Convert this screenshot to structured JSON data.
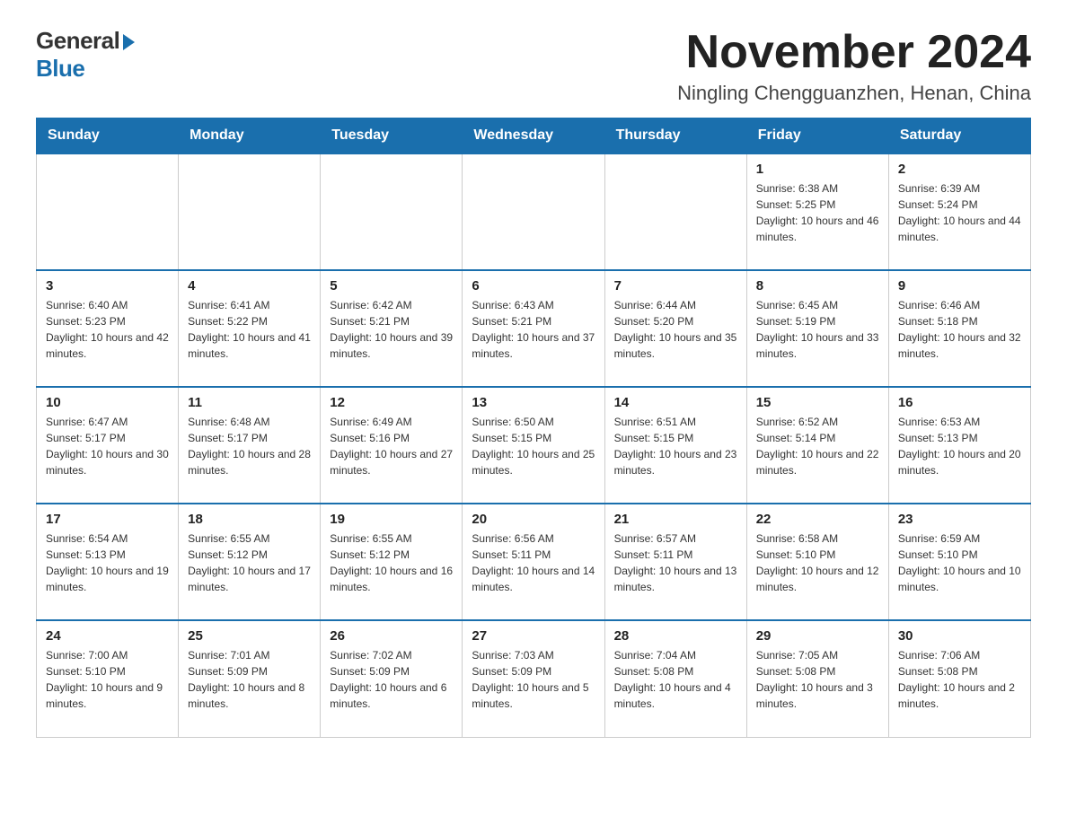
{
  "logo": {
    "general": "General",
    "blue": "Blue"
  },
  "header": {
    "month": "November 2024",
    "location": "Ningling Chengguanzhen, Henan, China"
  },
  "weekdays": [
    "Sunday",
    "Monday",
    "Tuesday",
    "Wednesday",
    "Thursday",
    "Friday",
    "Saturday"
  ],
  "weeks": [
    [
      {
        "day": "",
        "sunrise": "",
        "sunset": "",
        "daylight": ""
      },
      {
        "day": "",
        "sunrise": "",
        "sunset": "",
        "daylight": ""
      },
      {
        "day": "",
        "sunrise": "",
        "sunset": "",
        "daylight": ""
      },
      {
        "day": "",
        "sunrise": "",
        "sunset": "",
        "daylight": ""
      },
      {
        "day": "",
        "sunrise": "",
        "sunset": "",
        "daylight": ""
      },
      {
        "day": "1",
        "sunrise": "Sunrise: 6:38 AM",
        "sunset": "Sunset: 5:25 PM",
        "daylight": "Daylight: 10 hours and 46 minutes."
      },
      {
        "day": "2",
        "sunrise": "Sunrise: 6:39 AM",
        "sunset": "Sunset: 5:24 PM",
        "daylight": "Daylight: 10 hours and 44 minutes."
      }
    ],
    [
      {
        "day": "3",
        "sunrise": "Sunrise: 6:40 AM",
        "sunset": "Sunset: 5:23 PM",
        "daylight": "Daylight: 10 hours and 42 minutes."
      },
      {
        "day": "4",
        "sunrise": "Sunrise: 6:41 AM",
        "sunset": "Sunset: 5:22 PM",
        "daylight": "Daylight: 10 hours and 41 minutes."
      },
      {
        "day": "5",
        "sunrise": "Sunrise: 6:42 AM",
        "sunset": "Sunset: 5:21 PM",
        "daylight": "Daylight: 10 hours and 39 minutes."
      },
      {
        "day": "6",
        "sunrise": "Sunrise: 6:43 AM",
        "sunset": "Sunset: 5:21 PM",
        "daylight": "Daylight: 10 hours and 37 minutes."
      },
      {
        "day": "7",
        "sunrise": "Sunrise: 6:44 AM",
        "sunset": "Sunset: 5:20 PM",
        "daylight": "Daylight: 10 hours and 35 minutes."
      },
      {
        "day": "8",
        "sunrise": "Sunrise: 6:45 AM",
        "sunset": "Sunset: 5:19 PM",
        "daylight": "Daylight: 10 hours and 33 minutes."
      },
      {
        "day": "9",
        "sunrise": "Sunrise: 6:46 AM",
        "sunset": "Sunset: 5:18 PM",
        "daylight": "Daylight: 10 hours and 32 minutes."
      }
    ],
    [
      {
        "day": "10",
        "sunrise": "Sunrise: 6:47 AM",
        "sunset": "Sunset: 5:17 PM",
        "daylight": "Daylight: 10 hours and 30 minutes."
      },
      {
        "day": "11",
        "sunrise": "Sunrise: 6:48 AM",
        "sunset": "Sunset: 5:17 PM",
        "daylight": "Daylight: 10 hours and 28 minutes."
      },
      {
        "day": "12",
        "sunrise": "Sunrise: 6:49 AM",
        "sunset": "Sunset: 5:16 PM",
        "daylight": "Daylight: 10 hours and 27 minutes."
      },
      {
        "day": "13",
        "sunrise": "Sunrise: 6:50 AM",
        "sunset": "Sunset: 5:15 PM",
        "daylight": "Daylight: 10 hours and 25 minutes."
      },
      {
        "day": "14",
        "sunrise": "Sunrise: 6:51 AM",
        "sunset": "Sunset: 5:15 PM",
        "daylight": "Daylight: 10 hours and 23 minutes."
      },
      {
        "day": "15",
        "sunrise": "Sunrise: 6:52 AM",
        "sunset": "Sunset: 5:14 PM",
        "daylight": "Daylight: 10 hours and 22 minutes."
      },
      {
        "day": "16",
        "sunrise": "Sunrise: 6:53 AM",
        "sunset": "Sunset: 5:13 PM",
        "daylight": "Daylight: 10 hours and 20 minutes."
      }
    ],
    [
      {
        "day": "17",
        "sunrise": "Sunrise: 6:54 AM",
        "sunset": "Sunset: 5:13 PM",
        "daylight": "Daylight: 10 hours and 19 minutes."
      },
      {
        "day": "18",
        "sunrise": "Sunrise: 6:55 AM",
        "sunset": "Sunset: 5:12 PM",
        "daylight": "Daylight: 10 hours and 17 minutes."
      },
      {
        "day": "19",
        "sunrise": "Sunrise: 6:55 AM",
        "sunset": "Sunset: 5:12 PM",
        "daylight": "Daylight: 10 hours and 16 minutes."
      },
      {
        "day": "20",
        "sunrise": "Sunrise: 6:56 AM",
        "sunset": "Sunset: 5:11 PM",
        "daylight": "Daylight: 10 hours and 14 minutes."
      },
      {
        "day": "21",
        "sunrise": "Sunrise: 6:57 AM",
        "sunset": "Sunset: 5:11 PM",
        "daylight": "Daylight: 10 hours and 13 minutes."
      },
      {
        "day": "22",
        "sunrise": "Sunrise: 6:58 AM",
        "sunset": "Sunset: 5:10 PM",
        "daylight": "Daylight: 10 hours and 12 minutes."
      },
      {
        "day": "23",
        "sunrise": "Sunrise: 6:59 AM",
        "sunset": "Sunset: 5:10 PM",
        "daylight": "Daylight: 10 hours and 10 minutes."
      }
    ],
    [
      {
        "day": "24",
        "sunrise": "Sunrise: 7:00 AM",
        "sunset": "Sunset: 5:10 PM",
        "daylight": "Daylight: 10 hours and 9 minutes."
      },
      {
        "day": "25",
        "sunrise": "Sunrise: 7:01 AM",
        "sunset": "Sunset: 5:09 PM",
        "daylight": "Daylight: 10 hours and 8 minutes."
      },
      {
        "day": "26",
        "sunrise": "Sunrise: 7:02 AM",
        "sunset": "Sunset: 5:09 PM",
        "daylight": "Daylight: 10 hours and 6 minutes."
      },
      {
        "day": "27",
        "sunrise": "Sunrise: 7:03 AM",
        "sunset": "Sunset: 5:09 PM",
        "daylight": "Daylight: 10 hours and 5 minutes."
      },
      {
        "day": "28",
        "sunrise": "Sunrise: 7:04 AM",
        "sunset": "Sunset: 5:08 PM",
        "daylight": "Daylight: 10 hours and 4 minutes."
      },
      {
        "day": "29",
        "sunrise": "Sunrise: 7:05 AM",
        "sunset": "Sunset: 5:08 PM",
        "daylight": "Daylight: 10 hours and 3 minutes."
      },
      {
        "day": "30",
        "sunrise": "Sunrise: 7:06 AM",
        "sunset": "Sunset: 5:08 PM",
        "daylight": "Daylight: 10 hours and 2 minutes."
      }
    ]
  ]
}
